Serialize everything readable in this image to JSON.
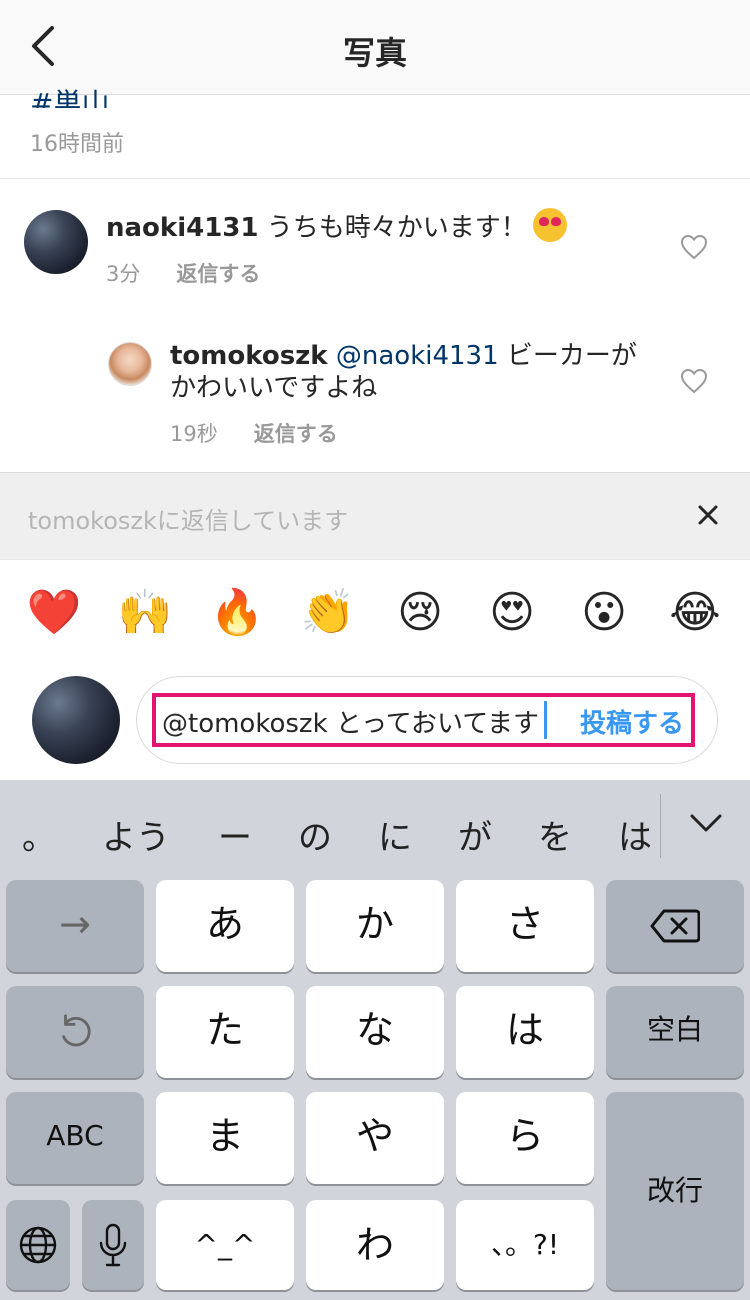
{
  "header": {
    "title": "写真",
    "back_icon": "chevron-left-icon"
  },
  "post": {
    "hashtag": "#巣山",
    "time": "16時間前"
  },
  "comments": [
    {
      "user": "naoki4131",
      "text": "うちも時々かいます！",
      "emoji": "heart-eyes",
      "time": "3分",
      "reply_label": "返信する"
    },
    {
      "user": "tomokoszk",
      "mention": "@naoki4131",
      "text_line1": "ビーカーが",
      "text_line2": "かわいいですよね",
      "time": "19秒",
      "reply_label": "返信する"
    }
  ],
  "reply_bar": {
    "text": "tomokoszkに返信しています",
    "close_icon": "close-icon"
  },
  "emoji_bar": [
    "❤️",
    "🙌",
    "🔥",
    "👏",
    "😢",
    "😍",
    "😮",
    "😂"
  ],
  "composer": {
    "value": "@tomokoszk とっておいてます",
    "post_label": "投稿する"
  },
  "keyboard": {
    "candidates": [
      "。",
      "よう",
      "ー",
      "の",
      "に",
      "が",
      "を",
      "は"
    ],
    "row1": [
      "→",
      "あ",
      "か",
      "さ",
      "⌫"
    ],
    "row2": [
      "↺",
      "た",
      "な",
      "は",
      "空白"
    ],
    "row3": [
      "ABC",
      "ま",
      "や",
      "ら",
      "改行"
    ],
    "row4": [
      "🌐",
      "🎤",
      "^_^",
      "わ",
      "、。?!"
    ]
  }
}
